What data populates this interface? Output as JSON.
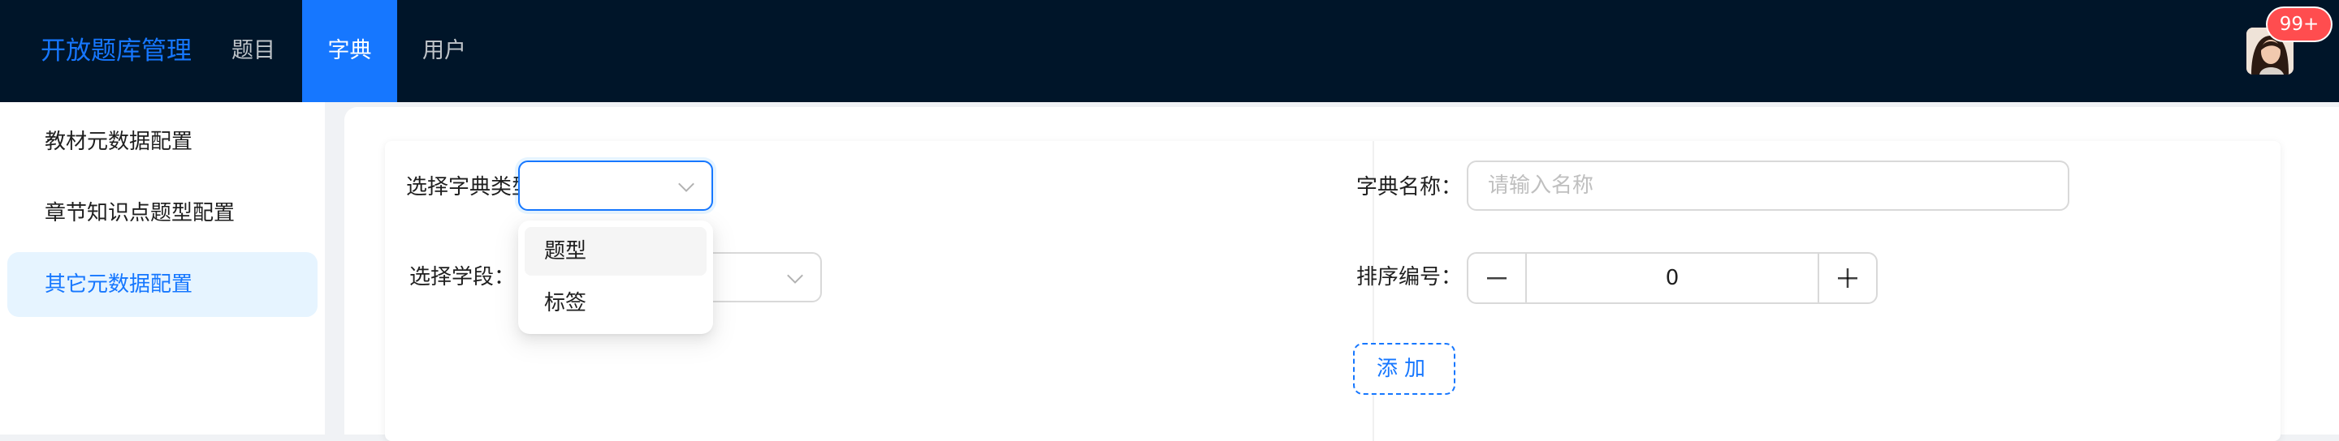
{
  "header": {
    "brand": "开放题库管理",
    "nav": [
      {
        "label": "题目",
        "active": false
      },
      {
        "label": "字典",
        "active": true
      },
      {
        "label": "用户",
        "active": false
      }
    ],
    "notification_badge": "99+"
  },
  "sidebar": {
    "items": [
      {
        "label": "教材元数据配置",
        "active": false
      },
      {
        "label": "章节知识点题型配置",
        "active": false
      },
      {
        "label": "其它元数据配置",
        "active": true
      }
    ]
  },
  "form_left": {
    "dict_type_label": "选择字典类型：",
    "dict_type_value": "",
    "dict_type_options": [
      "题型",
      "标签"
    ],
    "stage_label": "选择学段："
  },
  "form_right": {
    "name_label": "字典名称：",
    "name_placeholder": "请输入名称",
    "sort_label": "排序编号：",
    "sort_value": "0",
    "add_button": "添加"
  },
  "colors": {
    "header_bg": "#001529",
    "primary": "#1677ff",
    "active_side_bg": "#e6f4ff",
    "badge": "#ff4d4f"
  },
  "icons": [
    "chevron-down-icon",
    "minus-icon",
    "plus-icon"
  ]
}
